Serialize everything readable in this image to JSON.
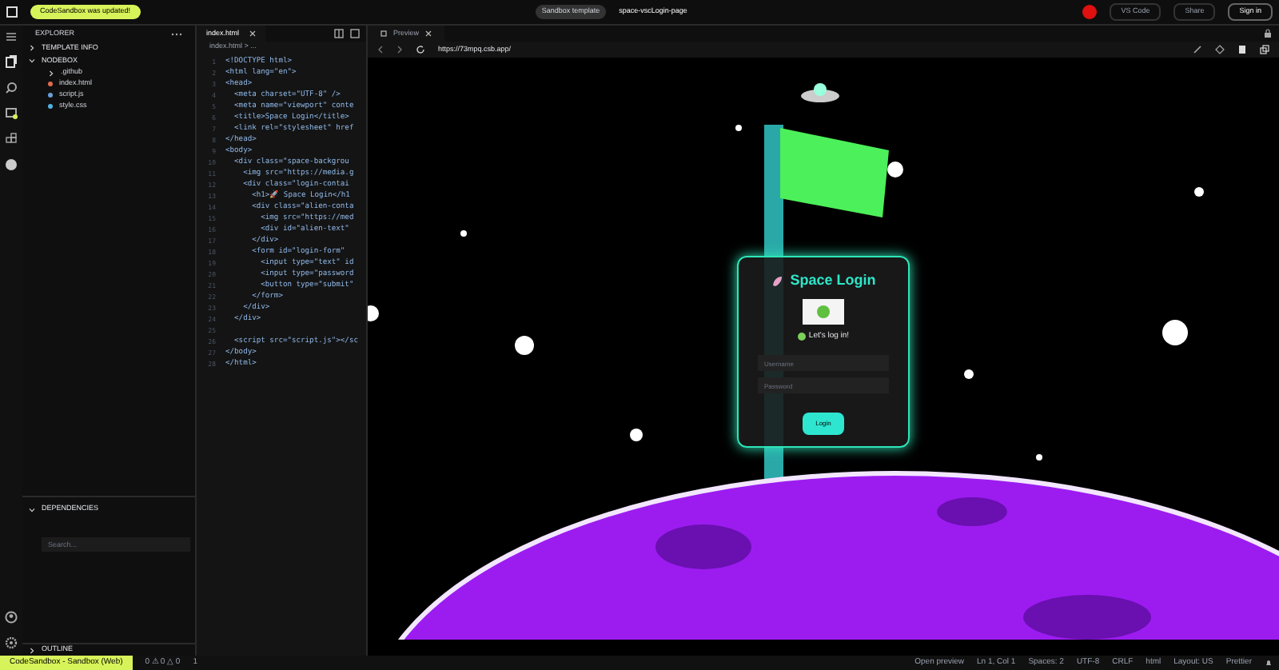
{
  "top_bar": {
    "notice": "CodeSandbox was updated!",
    "template": "Sandbox template",
    "project": "space-vscLogin-page",
    "buttons": [
      "VS Code",
      "Share",
      "Sign in"
    ]
  },
  "explorer": {
    "title": "EXPLORER",
    "sections": [
      {
        "label": "TEMPLATE INFO",
        "expanded": false
      },
      {
        "label": "NODEBOX",
        "expanded": true,
        "children": [
          {
            "label": ".github",
            "kind": "folder"
          },
          {
            "label": "index.html",
            "kind": "html"
          },
          {
            "label": "script.js",
            "kind": "js"
          },
          {
            "label": "style.css",
            "kind": "css"
          }
        ]
      }
    ],
    "dependencies": {
      "label": "DEPENDENCIES",
      "placeholder": "Search..."
    },
    "outline": "OUTLINE"
  },
  "editor": {
    "tab": "index.html",
    "breadcrumb": "index.html > ...",
    "lines": [
      {
        "number": "1",
        "text": "<!DOCTYPE html>"
      },
      {
        "number": "2",
        "text": "<html lang=\"en\">"
      },
      {
        "number": "3",
        "text": "<head>"
      },
      {
        "number": "4",
        "text": "  <meta charset=\"UTF-8\" />"
      },
      {
        "number": "5",
        "text": "  <meta name=\"viewport\" conte"
      },
      {
        "number": "6",
        "text": "  <title>Space Login</title>"
      },
      {
        "number": "7",
        "text": "  <link rel=\"stylesheet\" href"
      },
      {
        "number": "8",
        "text": "</head>"
      },
      {
        "number": "9",
        "text": "<body>"
      },
      {
        "number": "10",
        "text": "  <div class=\"space-backgrou"
      },
      {
        "number": "11",
        "text": "    <img src=\"https://media.g"
      },
      {
        "number": "12",
        "text": "    <div class=\"login-contai"
      },
      {
        "number": "13",
        "text": "      <h1>🚀 Space Login</h1"
      },
      {
        "number": "14",
        "text": "      <div class=\"alien-conta"
      },
      {
        "number": "15",
        "text": "        <img src=\"https://med"
      },
      {
        "number": "16",
        "text": "        <div id=\"alien-text\""
      },
      {
        "number": "17",
        "text": "      </div>"
      },
      {
        "number": "18",
        "text": "      <form id=\"login-form\""
      },
      {
        "number": "19",
        "text": "        <input type=\"text\" id"
      },
      {
        "number": "20",
        "text": "        <input type=\"password"
      },
      {
        "number": "21",
        "text": "        <button type=\"submit\""
      },
      {
        "number": "22",
        "text": "      </form>"
      },
      {
        "number": "23",
        "text": "    </div>"
      },
      {
        "number": "24",
        "text": "  </div>"
      },
      {
        "number": "25"
      },
      {
        "number": "26",
        "text": "  <script src=\"script.js\"></sc"
      },
      {
        "number": "27",
        "text": "</body>"
      },
      {
        "number": "28",
        "text": "</html>"
      }
    ]
  },
  "preview": {
    "tab": "Preview",
    "url": "https://73mpq.csb.app/",
    "card": {
      "title": "Space Login",
      "subtitle": "Let's log in!",
      "fields": [
        {
          "placeholder": "Username"
        },
        {
          "placeholder": "Password"
        }
      ],
      "button": "Login"
    }
  },
  "status_bar": {
    "left": "CodeSandbox - Sandbox (Web)",
    "problems": "0 ⚠ 0 △ 0",
    "ports": "1",
    "right": [
      "Open preview",
      "Ln 1, Col 1",
      "Spaces: 2",
      "UTF-8",
      "CRLF",
      "html",
      "Layout: US",
      "Prettier"
    ]
  }
}
